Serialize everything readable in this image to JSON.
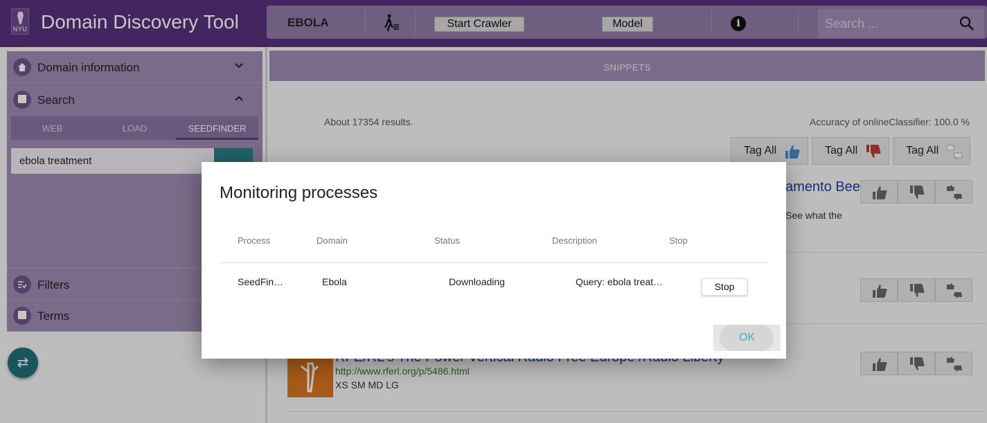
{
  "header": {
    "logo_text": "NYU",
    "app_title": "Domain Discovery Tool",
    "domain_name": "EBOLA",
    "start_crawler_label": "Start Crawler",
    "model_label": "Model",
    "search_placeholder": "Search ...",
    "icons": [
      "walking-person-icon",
      "info-icon",
      "search-icon"
    ]
  },
  "sidebar": {
    "sections": [
      {
        "label": "Domain information",
        "icon": "home-icon",
        "expanded": false
      },
      {
        "label": "Search",
        "icon": "search-section-icon",
        "expanded": true
      },
      {
        "label": "Filters",
        "icon": "filter-icon"
      },
      {
        "label": "Terms",
        "icon": "terms-icon"
      }
    ],
    "search_tabs": [
      "WEB",
      "LOAD",
      "SEEDFINDER"
    ],
    "active_tab": "SEEDFINDER",
    "query_value": "ebola treatment"
  },
  "main": {
    "tab_label": "SNIPPETS",
    "results_count": "About 17354 results.",
    "accuracy": "Accuracy of onlineClassifier: 100.0 %",
    "tag_all_label": "Tag All",
    "results": [
      {
        "title_fragment": "amento Bee",
        "snippet_fragment": "See what the"
      },
      {
        "title_fragment": "",
        "snippet_fragment": ""
      },
      {
        "title": "RFE/RL's The Power Vertical Radio Free Europe /Radio Liberty",
        "url": "http://www.rferl.org/p/5486.html",
        "sizes": "XS SM MD LG"
      }
    ]
  },
  "modal": {
    "title": "Monitoring processes",
    "columns": [
      "Process",
      "Domain",
      "Status",
      "Description",
      "Stop"
    ],
    "rows": [
      {
        "process": "SeedFin…",
        "domain": "Ebola",
        "status": "Downloading",
        "description": "Query: ebola treat…",
        "stop_label": "Stop"
      }
    ],
    "ok_label": "OK"
  },
  "colors": {
    "header_purple": "#57307a",
    "sidebar_purple": "#9b89b0",
    "teal": "#2b7d86",
    "link_blue": "#1a3e9e",
    "thumb_down_red": "#c0392b",
    "thumb_up_blue": "#4a84c4"
  }
}
